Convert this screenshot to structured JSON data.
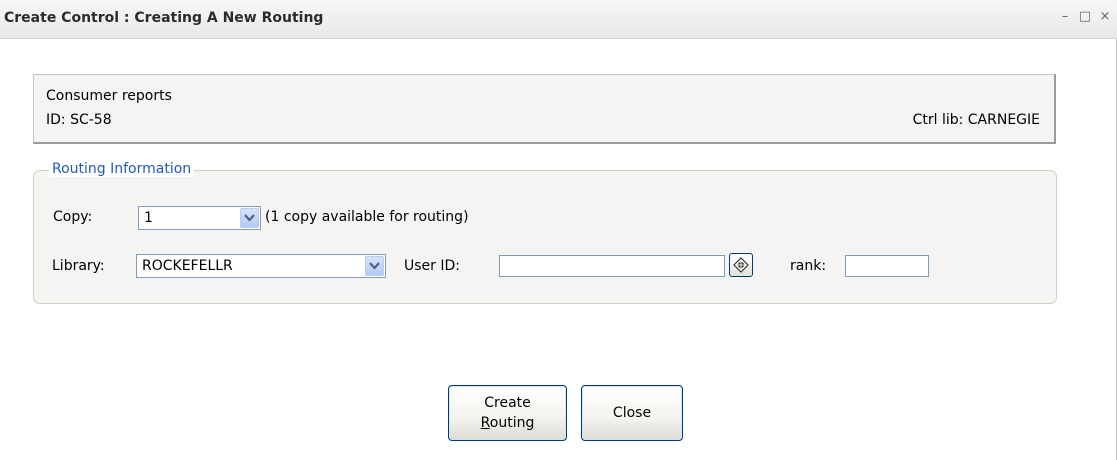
{
  "window": {
    "title": "Create Control : Creating A New Routing",
    "controls": {
      "minimize": "–",
      "maximize": "□",
      "close": "×"
    }
  },
  "info": {
    "name": "Consumer reports",
    "id": "ID: SC-58",
    "ctrl_lib": "Ctrl lib: CARNEGIE"
  },
  "routing": {
    "legend": "Routing Information",
    "copy_label": "Copy:",
    "copy_value": "1",
    "copy_note": "(1 copy available for routing)",
    "library_label": "Library:",
    "library_value": "ROCKEFELLR",
    "user_id_label": "User ID:",
    "user_id_value": "",
    "rank_label": "rank:",
    "rank_value": ""
  },
  "buttons": {
    "create_line1": "Create",
    "create_line2_first": "R",
    "create_line2_rest": "outing",
    "close": "Close"
  },
  "icons": {
    "dropdown": "chevron-down-icon",
    "lookup": "lookup-icon"
  },
  "colors": {
    "legend": "#1f5bbf",
    "button_border": "#003c74"
  }
}
